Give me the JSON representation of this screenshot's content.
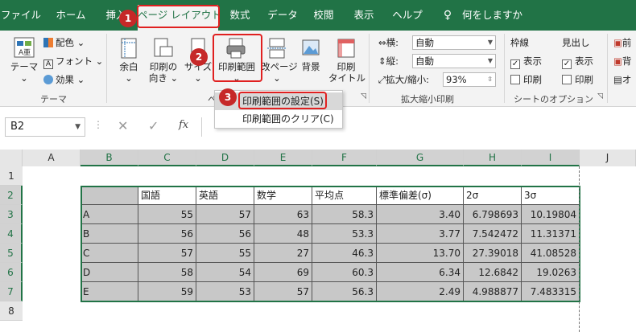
{
  "tabs": [
    "ファイル",
    "ホーム",
    "挿入",
    "ページ レイアウト",
    "数式",
    "データ",
    "校閲",
    "表示",
    "ヘルプ"
  ],
  "tell_me": "何をしますか",
  "ribbon": {
    "theme_group": {
      "theme": "テーマ",
      "colors": "配色",
      "fonts": "フォント",
      "effects": "効果",
      "label": "テーマ"
    },
    "page_setup": {
      "margins": "余白",
      "orientation_1": "印刷の",
      "orientation_2": "向き",
      "size": "サイズ",
      "print_area": "印刷範囲",
      "breaks": "改ページ",
      "background": "背景",
      "print_titles_1": "印刷",
      "print_titles_2": "タイトル",
      "label": "ペ"
    },
    "scale": {
      "width_label": "横:",
      "width_value": "自動",
      "height_label": "縦:",
      "height_value": "自動",
      "scale_label": "拡大/縮小:",
      "scale_value": "93%",
      "label": "拡大縮小印刷"
    },
    "sheet_options": {
      "gridlines": "枠線",
      "headings": "見出し",
      "view": "表示",
      "print": "印刷",
      "label": "シートのオプション"
    },
    "arrange": {
      "front": "前",
      "back": "背",
      "pane": "オ"
    }
  },
  "dropdown": {
    "set_print_area": "印刷範囲の設定(S)",
    "clear_print_area": "印刷範囲のクリア(C)"
  },
  "badges": [
    "1",
    "2",
    "3"
  ],
  "formula_bar": {
    "name_box": "B2",
    "fx": "fx",
    "value": ""
  },
  "columns": [
    "A",
    "B",
    "C",
    "D",
    "E",
    "F",
    "G",
    "H",
    "I",
    "J"
  ],
  "rows": [
    "1",
    "2",
    "3",
    "4",
    "5",
    "6",
    "7",
    "8"
  ],
  "table": {
    "header": [
      "",
      "国語",
      "英語",
      "数学",
      "平均点",
      "標準偏差(σ)",
      "2σ",
      "3σ"
    ],
    "data": [
      [
        "A",
        "55",
        "57",
        "63",
        "58.3",
        "3.40",
        "6.798693",
        "10.19804"
      ],
      [
        "B",
        "56",
        "56",
        "48",
        "53.3",
        "3.77",
        "7.542472",
        "11.31371"
      ],
      [
        "C",
        "57",
        "55",
        "27",
        "46.3",
        "13.70",
        "27.39018",
        "41.08528"
      ],
      [
        "D",
        "58",
        "54",
        "69",
        "60.3",
        "6.34",
        "12.6842",
        "19.0263"
      ],
      [
        "E",
        "59",
        "53",
        "57",
        "56.3",
        "2.49",
        "4.988877",
        "7.483315"
      ]
    ]
  },
  "colors": {
    "excel_green": "#217346",
    "annotation_red": "#e02020",
    "print_area_fill": "#c8c8c8"
  }
}
